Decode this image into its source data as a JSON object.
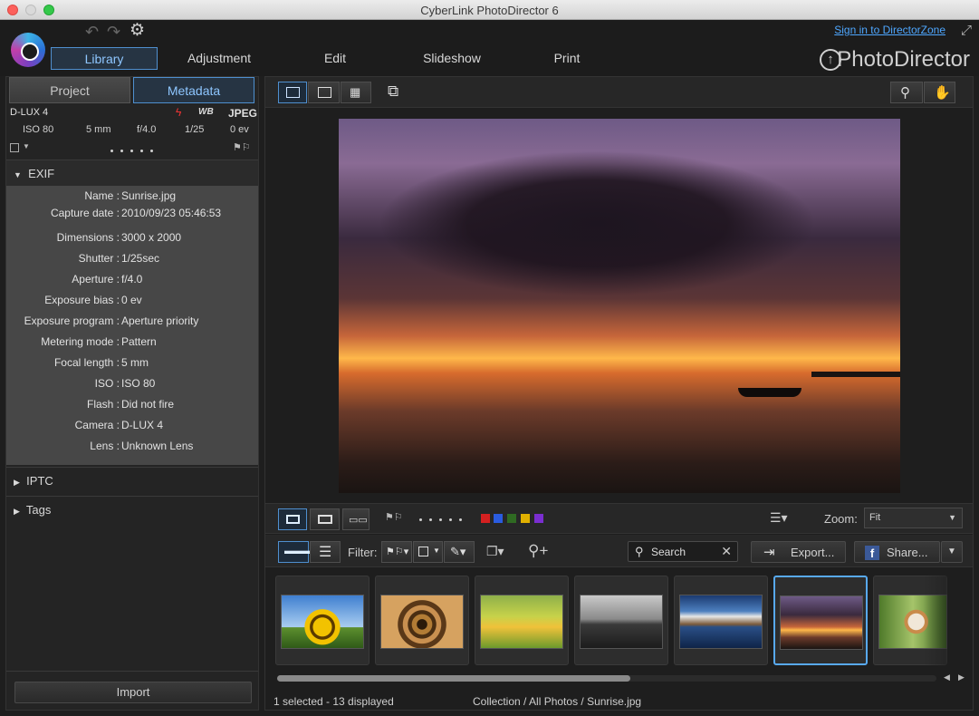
{
  "window": {
    "title": "CyberLink PhotoDirector 6"
  },
  "header": {
    "tabs": [
      {
        "label": "Library"
      },
      {
        "label": "Adjustment"
      },
      {
        "label": "Edit"
      },
      {
        "label": "Slideshow"
      },
      {
        "label": "Print"
      }
    ],
    "sign_in_link": "Sign in to DirectorZone",
    "brand": "PhotoDirector"
  },
  "left_panel": {
    "tabs": [
      {
        "label": "Project"
      },
      {
        "label": "Metadata"
      }
    ],
    "camera_model": "D-LUX 4",
    "file_format": "JPEG",
    "wb_badge": "WB",
    "shot_info": [
      "ISO 80",
      "5 mm",
      "f/4.0",
      "1/25",
      "0 ev"
    ],
    "exif": {
      "title": "EXIF",
      "rows": [
        {
          "key": "Name :",
          "value": "Sunrise.jpg"
        },
        {
          "key": "Capture date :",
          "value": "2010/09/23 05:46:53"
        },
        {
          "key": "Dimensions :",
          "value": "3000 x 2000"
        },
        {
          "key": "Shutter :",
          "value": "1/25sec"
        },
        {
          "key": "Aperture :",
          "value": "f/4.0"
        },
        {
          "key": "Exposure bias :",
          "value": "0 ev"
        },
        {
          "key": "Exposure program :",
          "value": "Aperture priority"
        },
        {
          "key": "Metering mode :",
          "value": "Pattern"
        },
        {
          "key": "Focal length :",
          "value": "5 mm"
        },
        {
          "key": "ISO :",
          "value": "ISO 80"
        },
        {
          "key": "Flash :",
          "value": "Did not fire"
        },
        {
          "key": "Camera :",
          "value": "D-LUX 4"
        },
        {
          "key": "Lens :",
          "value": "Unknown Lens"
        }
      ]
    },
    "iptc_label": "IPTC",
    "tags_label": "Tags",
    "import_label": "Import"
  },
  "viewer": {
    "zoom_label": "Zoom:",
    "zoom_value": "Fit",
    "color_labels": [
      "#d42020",
      "#2a5ce0",
      "#2f6a22",
      "#e0b000",
      "#7a2ed0"
    ]
  },
  "browser": {
    "filter_label": "Filter:",
    "search_label": "Search",
    "export_label": "Export...",
    "share_label": "Share...",
    "status_left": "1 selected - 13 displayed",
    "status_path": "Collection / All Photos / Sunrise.jpg",
    "thumbnails": [
      {
        "name": "sunflower"
      },
      {
        "name": "spiral staircase"
      },
      {
        "name": "bicycle in flowers"
      },
      {
        "name": "boat on shore"
      },
      {
        "name": "mountain lake"
      },
      {
        "name": "sunrise"
      },
      {
        "name": "cat in grass"
      }
    ]
  }
}
